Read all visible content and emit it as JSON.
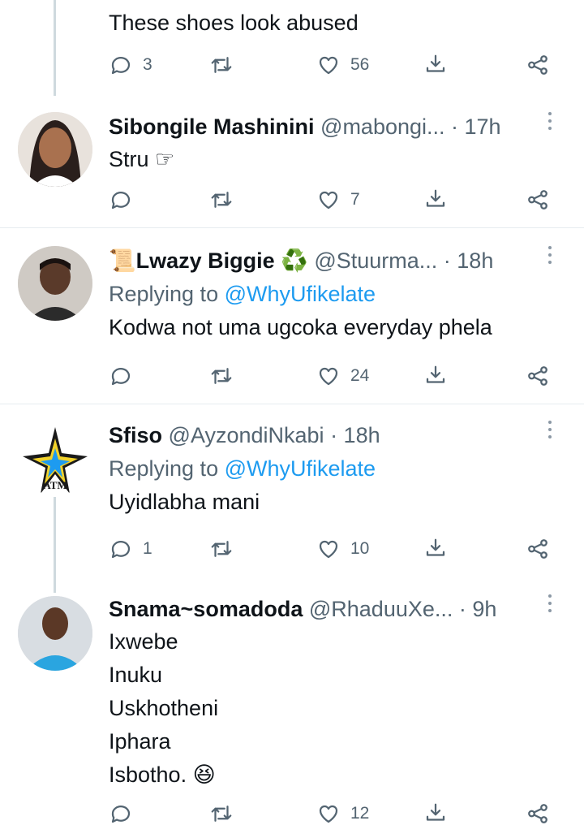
{
  "tweets": [
    {
      "text_lines": [
        "These shoes look abused"
      ],
      "replies": "3",
      "retweets": "",
      "likes": "56"
    },
    {
      "name": "Sibongile Mashinini",
      "handle": "@mabongi...",
      "time": "· 17h",
      "text_lines": [
        "Stru ☞"
      ],
      "replies": "",
      "retweets": "",
      "likes": "7"
    },
    {
      "name_prefix": "📜",
      "name": "Lwazy Biggie",
      "name_suffix": "♻️",
      "handle": "@Stuurma...",
      "time": "· 18h",
      "replying_prefix": "Replying to",
      "replying_to": "@WhyUfikelate",
      "text_lines": [
        "Kodwa not uma ugcoka everyday phela"
      ],
      "replies": "",
      "retweets": "",
      "likes": "24"
    },
    {
      "name": "Sfiso",
      "handle": "@AyzondiNkabi",
      "time": "· 18h",
      "avatar_text": "ATM",
      "replying_prefix": "Replying to",
      "replying_to": "@WhyUfikelate",
      "text_lines": [
        "Uyidlabha mani"
      ],
      "replies": "1",
      "retweets": "",
      "likes": "10"
    },
    {
      "name": "Snama~somadoda",
      "handle": "@RhaduuXe...",
      "time": "· 9h",
      "text_lines": [
        "Ixwebe",
        "Inuku",
        "Uskhotheni",
        "Iphara",
        "Isbotho. 😆"
      ],
      "replies": "",
      "retweets": "",
      "likes": "12"
    }
  ],
  "colors": {
    "accent": "#1d9bf0",
    "secondary_text": "#536471",
    "divider": "#e6ecf0",
    "thread_line": "#cfd9de"
  },
  "icons": [
    "reply-icon",
    "retweet-icon",
    "like-icon",
    "download-icon",
    "share-icon",
    "more-icon"
  ]
}
